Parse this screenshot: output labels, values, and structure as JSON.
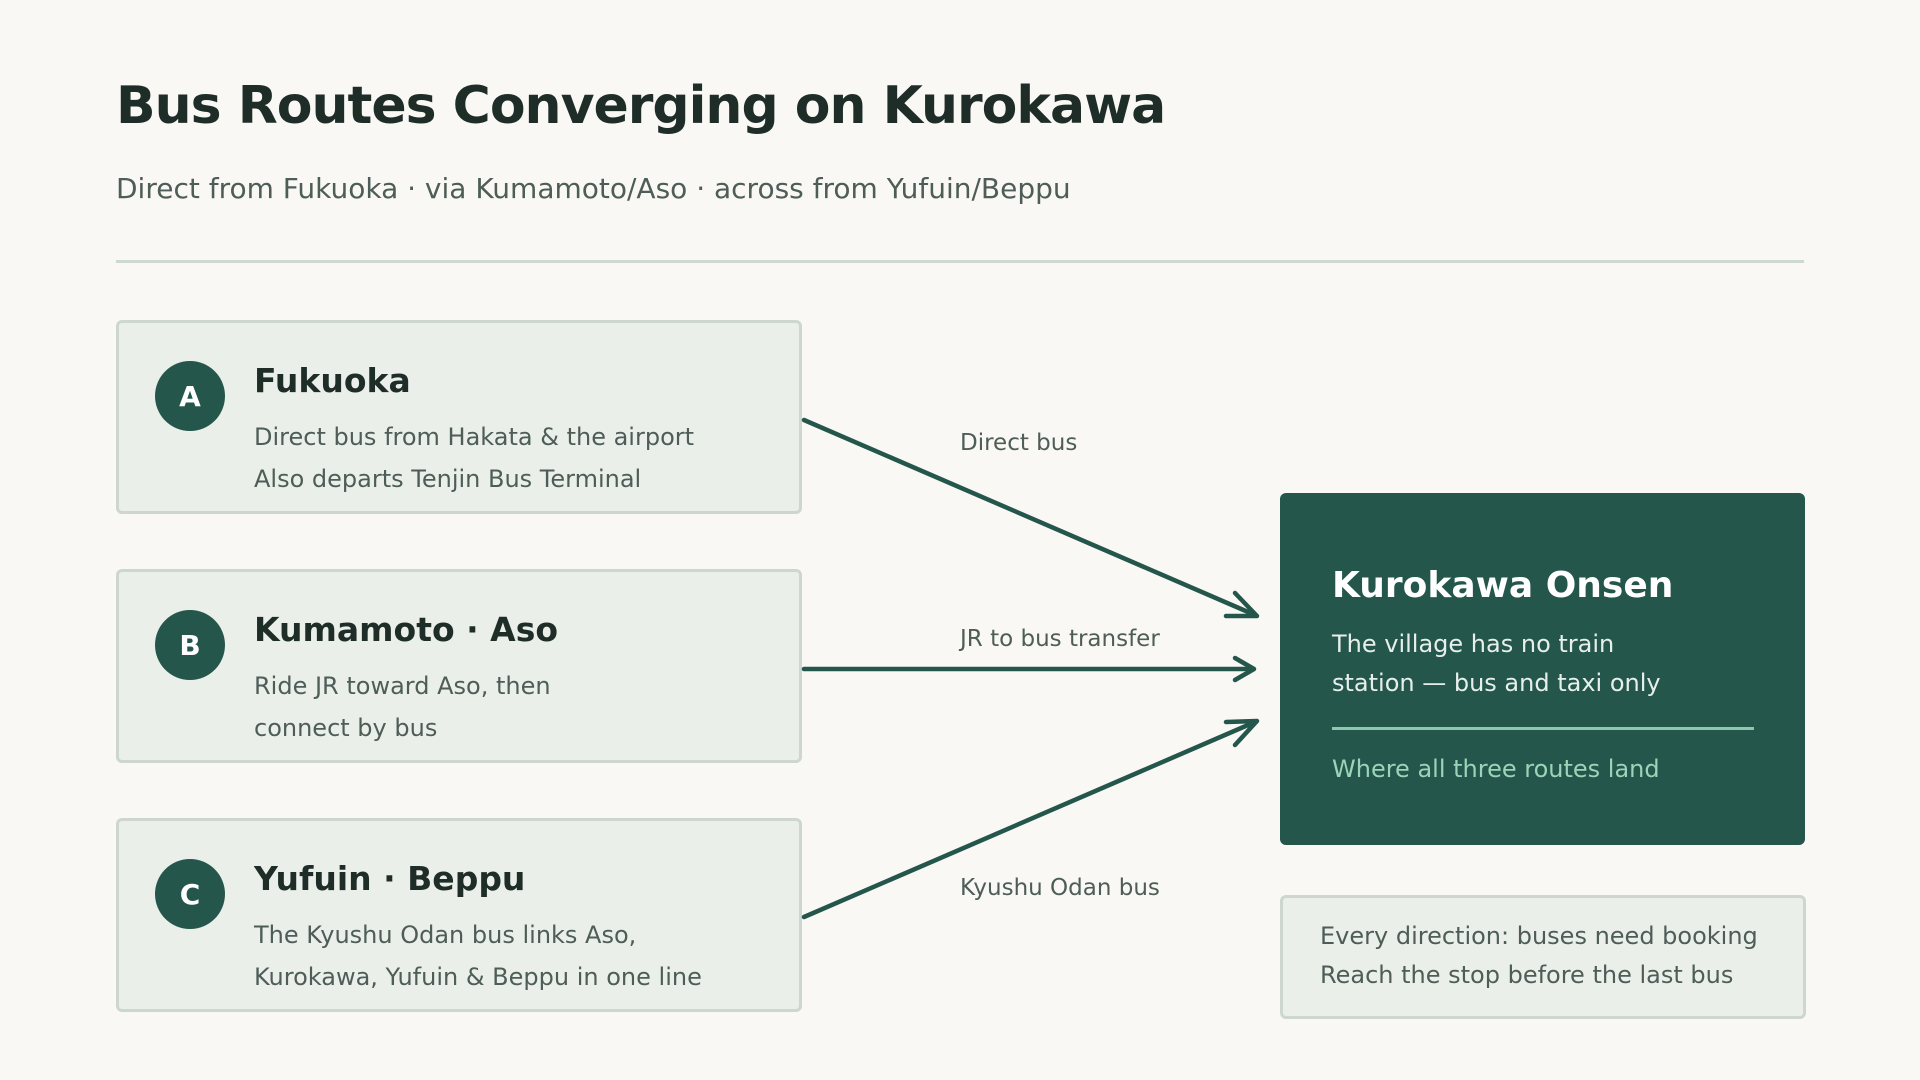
{
  "title": "Bus Routes Converging on Kurokawa",
  "subtitle": "Direct from Fukuoka · via Kumamoto/Aso · across from Yufuin/Beppu",
  "origins": [
    {
      "badge": "A",
      "title": "Fukuoka",
      "line1": "Direct bus from Hakata & the airport",
      "line2": "Also departs Tenjin Bus Terminal"
    },
    {
      "badge": "B",
      "title": "Kumamoto · Aso",
      "line1": "Ride JR toward Aso, then",
      "line2": "connect by bus"
    },
    {
      "badge": "C",
      "title": "Yufuin · Beppu",
      "line1": "The Kyushu Odan bus links Aso,",
      "line2": "Kurokawa, Yufuin & Beppu in one line"
    }
  ],
  "routes": [
    {
      "label": "Direct bus"
    },
    {
      "label": "JR to bus transfer"
    },
    {
      "label": "Kyushu Odan bus"
    }
  ],
  "destination": {
    "title": "Kurokawa Onsen",
    "line1": "The village has no train",
    "line2": "station — bus and taxi only",
    "note": "Where all three routes land"
  },
  "info": {
    "line1": "Every direction: buses need booking",
    "line2": "Reach the stop before the last bus"
  },
  "colors": {
    "accent": "#24564c",
    "background": "#f9f8f4",
    "card": "#ebefea",
    "highlight": "#9bd4b8"
  }
}
